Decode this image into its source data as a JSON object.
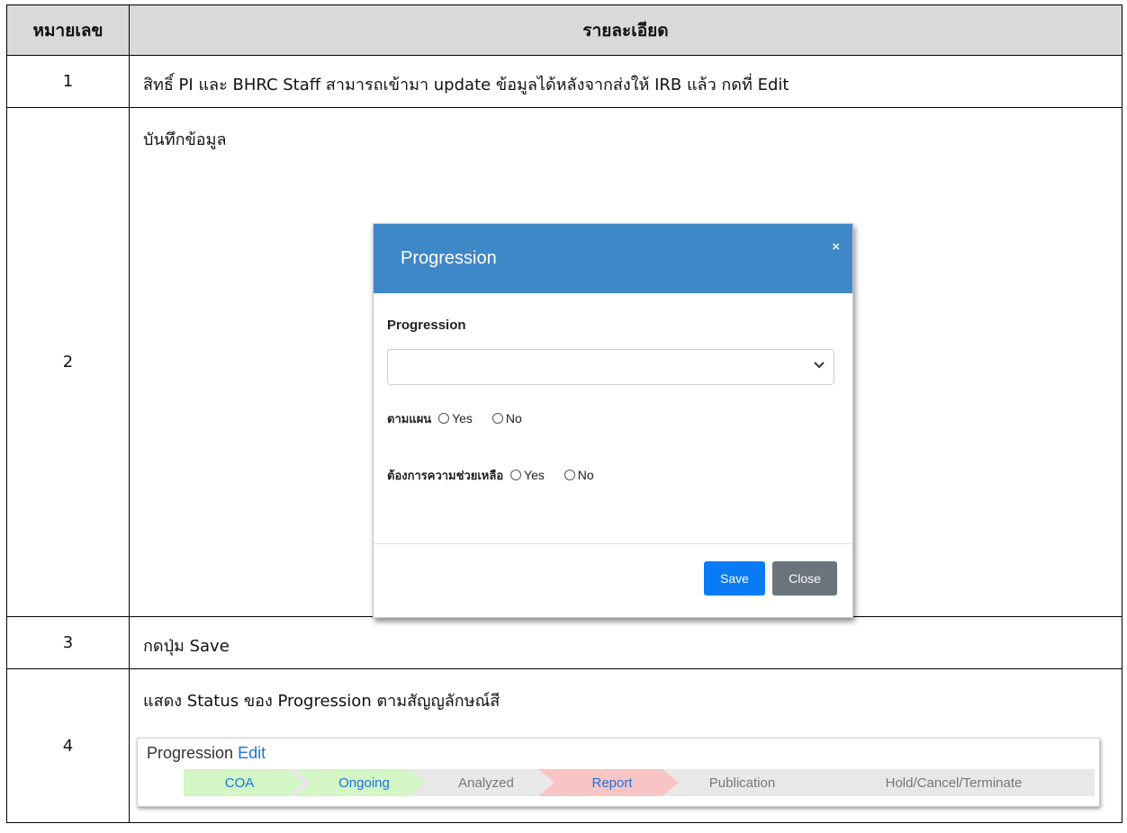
{
  "table": {
    "header_number": "หมายเลข",
    "header_detail": "รายละเอียด"
  },
  "rows": [
    {
      "number": "1",
      "text": "สิทธิ์ PI และ BHRC Staff สามารถเข้ามา update ข้อมูลได้หลังจากส่งให้ IRB แล้ว กดที่ Edit"
    },
    {
      "number": "2",
      "text": "บันทึกข้อมูล"
    },
    {
      "number": "3",
      "text": "กดปุ่ม Save"
    },
    {
      "number": "4",
      "text": "แสดง Status ของ Progression ตามสัญญลักษณ์สี"
    }
  ],
  "modal": {
    "title": "Progression",
    "close_glyph": "×",
    "field_label": "Progression",
    "select_value": "",
    "radio_group_1": {
      "label": "ตามแผน",
      "options": [
        "Yes",
        "No"
      ]
    },
    "radio_group_2": {
      "label": "ต้องการความช่วยเหลือ",
      "options": [
        "Yes",
        "No"
      ]
    },
    "save_label": "Save",
    "close_label": "Close",
    "header_color": "#3f88c8"
  },
  "progression": {
    "title": "Progression",
    "edit_link": "Edit",
    "steps": [
      {
        "label": "COA",
        "state": "done",
        "color": "#d4f5c4",
        "text_color": "#1a73e8"
      },
      {
        "label": "Ongoing",
        "state": "done",
        "color": "#d4f5c4",
        "text_color": "#1a73e8"
      },
      {
        "label": "Analyzed",
        "state": "pending",
        "color": "#e8e8e8",
        "text_color": "#777777"
      },
      {
        "label": "Report",
        "state": "flag",
        "color": "#f9c4c4",
        "text_color": "#1a73e8"
      },
      {
        "label": "Publication",
        "state": "pending",
        "color": "#e8e8e8",
        "text_color": "#777777"
      },
      {
        "label": "Hold/Cancel/Terminate",
        "state": "pending",
        "color": "#e8e8e8",
        "text_color": "#777777"
      }
    ]
  }
}
